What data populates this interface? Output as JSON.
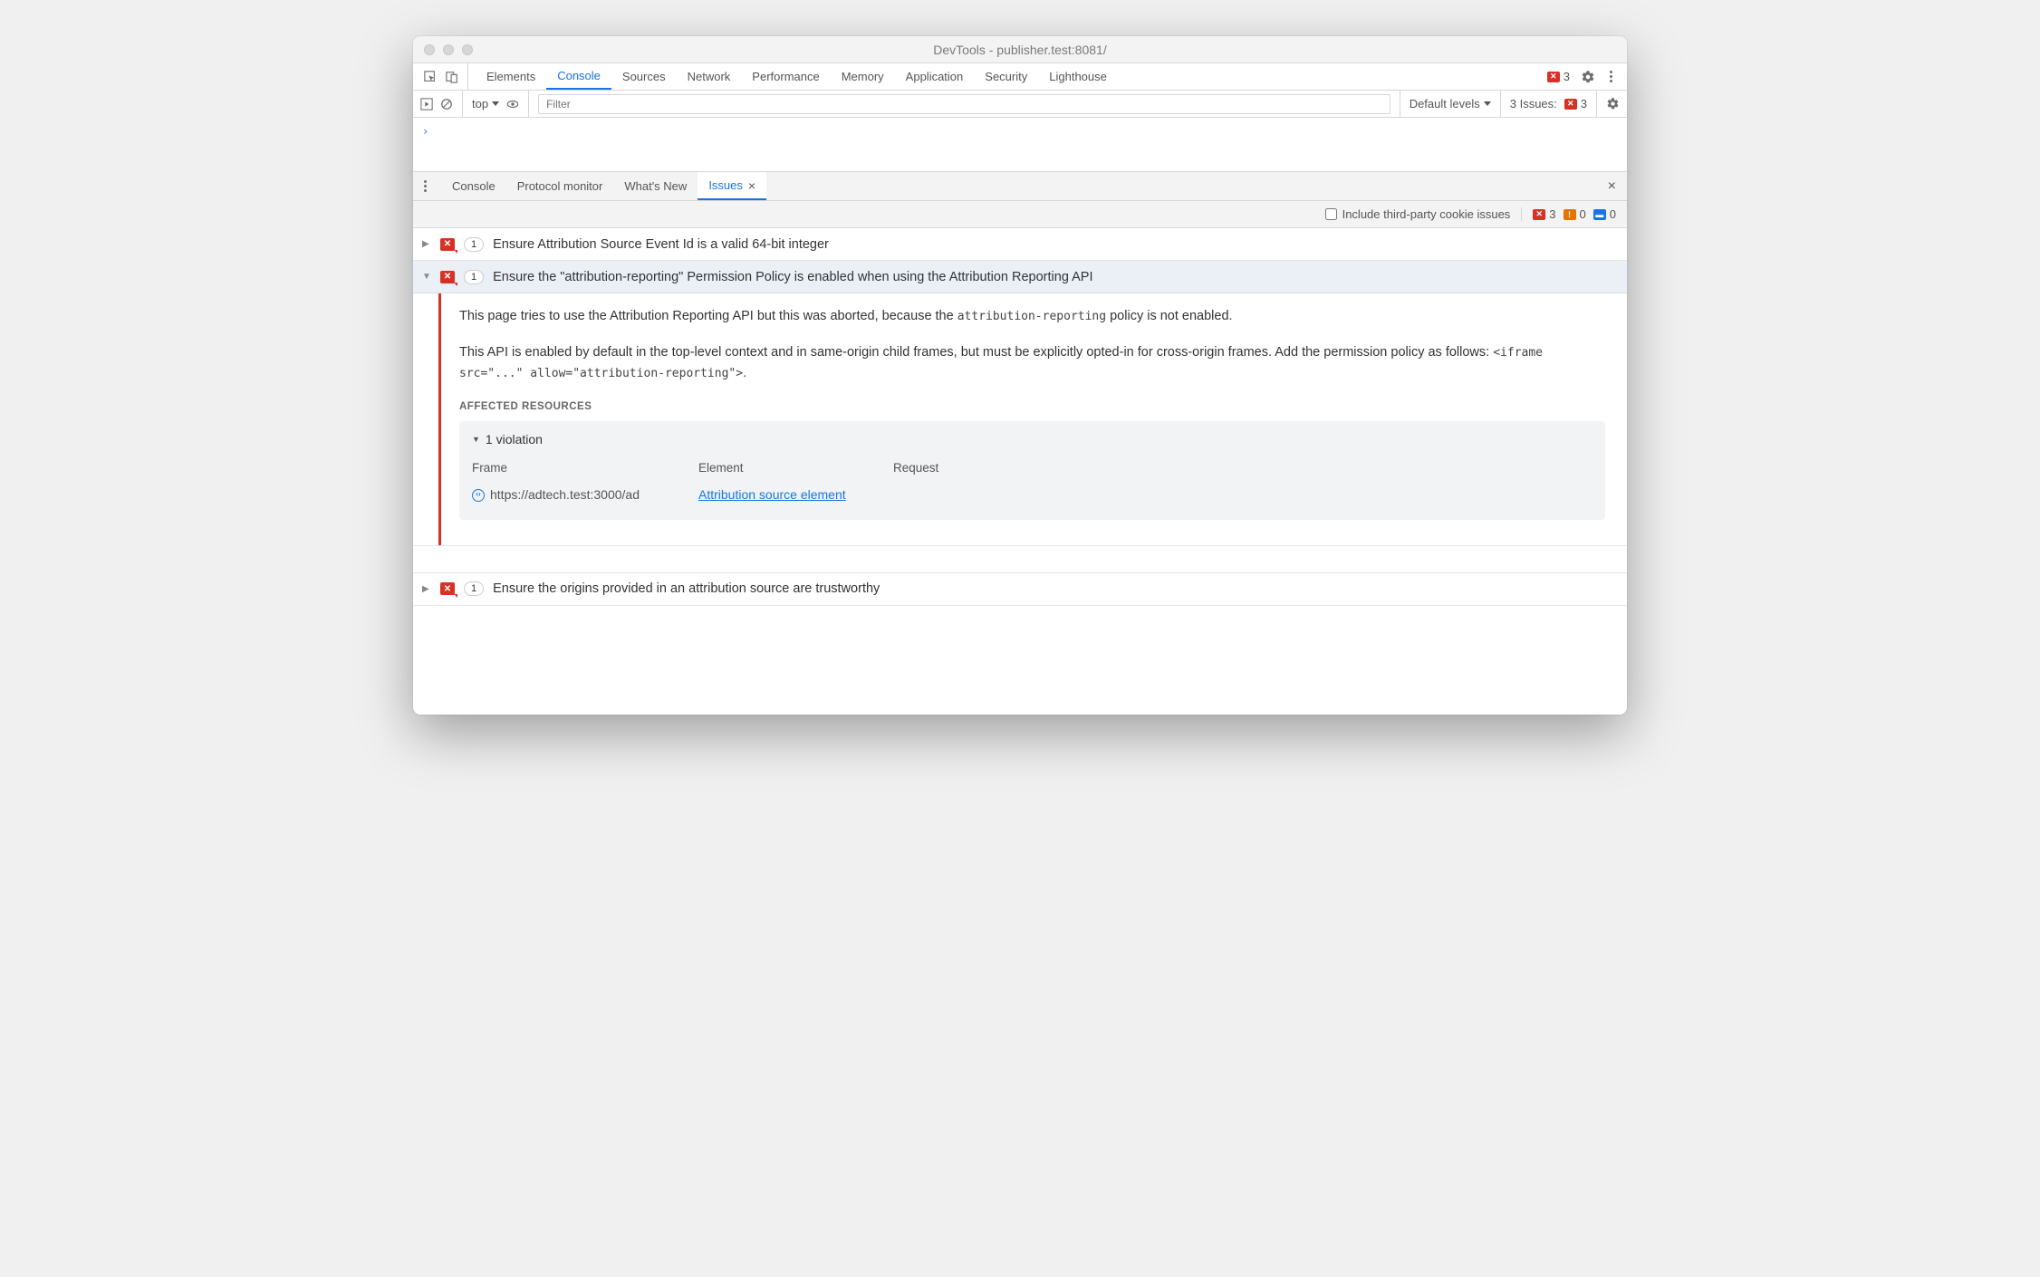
{
  "window": {
    "title": "DevTools - publisher.test:8081/"
  },
  "main_tabs": {
    "items": [
      "Elements",
      "Console",
      "Sources",
      "Network",
      "Performance",
      "Memory",
      "Application",
      "Security",
      "Lighthouse"
    ],
    "active_index": 1,
    "error_count": "3"
  },
  "console_toolbar": {
    "context": "top",
    "filter_placeholder": "Filter",
    "levels": "Default levels",
    "issues_label": "3 Issues:",
    "issues_count": "3"
  },
  "drawer": {
    "tabs": [
      "Console",
      "Protocol monitor",
      "What's New",
      "Issues"
    ],
    "active_index": 3
  },
  "issues_bar": {
    "checkbox_label": "Include third-party cookie issues",
    "red": "3",
    "orange": "0",
    "blue": "0"
  },
  "issues": [
    {
      "badge": "1",
      "title": "Ensure Attribution Source Event Id is a valid 64-bit integer",
      "expanded": false
    },
    {
      "badge": "1",
      "title": "Ensure the \"attribution-reporting\" Permission Policy is enabled when using the Attribution Reporting API",
      "expanded": true,
      "body": {
        "p1_a": "This page tries to use the Attribution Reporting API but this was aborted, because the ",
        "p1_code": "attribution-reporting",
        "p1_b": " policy is not enabled.",
        "p2_a": "This API is enabled by default in the top-level context and in same-origin child frames, but must be explicitly opted-in for cross-origin frames. Add the permission policy as follows: ",
        "p2_code": "<iframe src=\"...\" allow=\"attribution-reporting\">",
        "p2_b": ".",
        "affected_label": "Affected Resources",
        "violation_head": "1 violation",
        "cols": {
          "frame": "Frame",
          "element": "Element",
          "request": "Request"
        },
        "row": {
          "frame": "https://adtech.test:3000/ad",
          "element": "Attribution source element"
        }
      }
    },
    {
      "badge": "1",
      "title": "Ensure the origins provided in an attribution source are trustworthy",
      "expanded": false
    }
  ]
}
